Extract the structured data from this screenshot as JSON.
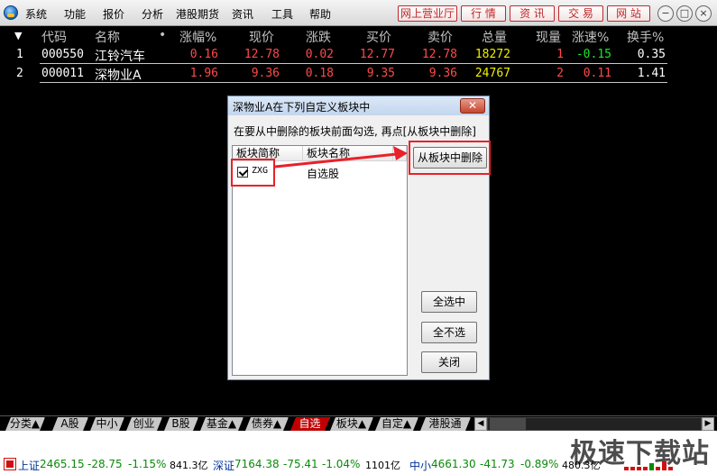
{
  "menu": {
    "items": [
      "系统",
      "功能",
      "报价",
      "分析",
      "港股期货",
      "资讯",
      "工具",
      "帮助"
    ]
  },
  "toolbar": {
    "buttons": [
      "网上营业厅",
      "行 情",
      "资 讯",
      "交 易",
      "网 站"
    ],
    "min_label": "−",
    "max_label": "□",
    "close_label": "×"
  },
  "table": {
    "sort_arrow": "▼",
    "headers": [
      "代码",
      "名称",
      "•",
      "涨幅%",
      "现价",
      "涨跌",
      "买价",
      "卖价",
      "总量",
      "现量",
      "涨速%",
      "换手%"
    ],
    "rows": [
      {
        "index": "1",
        "code": "000550",
        "name": "江铃汽车",
        "change_pct": "0.16",
        "price": "12.78",
        "change": "0.02",
        "bid": "12.77",
        "ask": "12.78",
        "volume": "18272",
        "cur_volume": "1",
        "speed": "-0.15",
        "turnover": "0.35"
      },
      {
        "index": "2",
        "code": "000011",
        "name": "深物业A",
        "change_pct": "1.96",
        "price": "9.36",
        "change": "0.18",
        "bid": "9.35",
        "ask": "9.36",
        "volume": "24767",
        "cur_volume": "2",
        "speed": "0.11",
        "turnover": "1.41"
      }
    ]
  },
  "dialog": {
    "title": "深物业A在下列自定义板块中",
    "close_label": "✕",
    "instruction": "在要从中删除的板块前面勾选, 再点[从板块中删除]",
    "col_short": "板块简称",
    "col_name": "板块名称",
    "rows": [
      {
        "short": "ZXG",
        "name": "自选股",
        "checked": true
      }
    ],
    "btn_delete": "从板块中删除",
    "btn_select_all": "全选中",
    "btn_select_none": "全不选",
    "btn_close": "关闭"
  },
  "tabs": [
    "分类▲",
    "A股",
    "中小",
    "创业",
    "B股",
    "基金▲",
    "债券▲",
    "自选",
    "板块▲",
    "自定▲",
    "港股通"
  ],
  "active_tab": "自选",
  "status": {
    "sh_label": "上证",
    "sh_index": "2465.15",
    "sh_change": "-28.75",
    "sh_pct": "-1.15%",
    "sh_amount": "841.3亿",
    "sz_label": "深证",
    "sz_index": "7164.38",
    "sz_change": "-75.41",
    "sz_pct": "-1.04%",
    "sz_amount": "1101亿",
    "zx_label": "中小",
    "zx_index": "4661.30",
    "zx_change": "-41.73",
    "zx_pct": "-0.89%",
    "zx_amount": "480.3亿"
  },
  "watermark": "极速下载站",
  "colors": {
    "up": "#ff4a4a",
    "down": "#19e62e",
    "volume": "#f0f000",
    "highlight": "#e8212a",
    "active_tab": "#c00000"
  }
}
